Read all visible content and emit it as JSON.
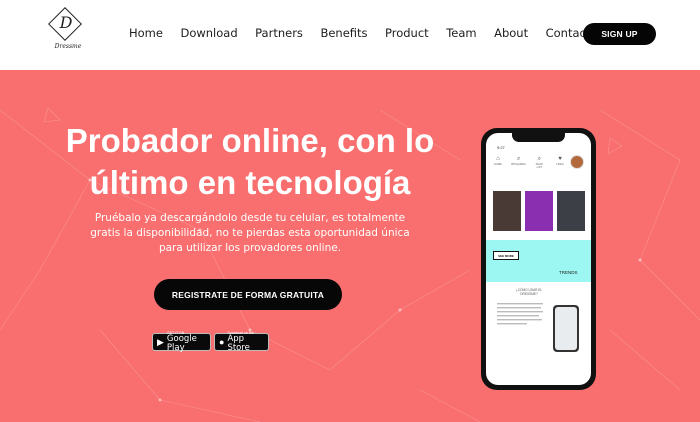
{
  "header": {
    "logo_letter": "D",
    "logo_text": "Dressme",
    "nav": [
      "Home",
      "Download",
      "Partners",
      "Benefits",
      "Product",
      "Team",
      "About",
      "Contact"
    ],
    "signup_label": "SIGN UP"
  },
  "hero": {
    "title_line1": "Probador online, con lo",
    "title_line2": "último en tecnología",
    "desc_line1": "Pruébalo ya descargándolo desde tu celular, es totalmente",
    "desc_line2": "gratis la disponibilidad, no te pierdas esta oportunidad única",
    "desc_line3": "para utilizar los provadores online.",
    "cta_label": "REGISTRATE DE FORMA GRATUITA",
    "google_play": {
      "small": "GET IT ON",
      "big": "Google Play"
    },
    "app_store": {
      "small": "Download on the",
      "big": "App Store"
    }
  },
  "phone": {
    "time": "9:27",
    "tabs": [
      {
        "glyph": "⌂",
        "label": "HOME"
      },
      {
        "glyph": "⌕",
        "label": "BÚSQUEDA"
      },
      {
        "glyph": "⌕",
        "label": "SHOP LIST"
      },
      {
        "glyph": "♥",
        "label": "LIKES"
      }
    ],
    "see_more": "SEE MORE",
    "trends": "TRENDS",
    "how_to": "¿CÓMO USAR EL DRESSME?"
  },
  "colors": {
    "hero_bg": "#f96e6e",
    "accent_dark": "#050505",
    "phone_cyan": "#9cf7f2"
  }
}
